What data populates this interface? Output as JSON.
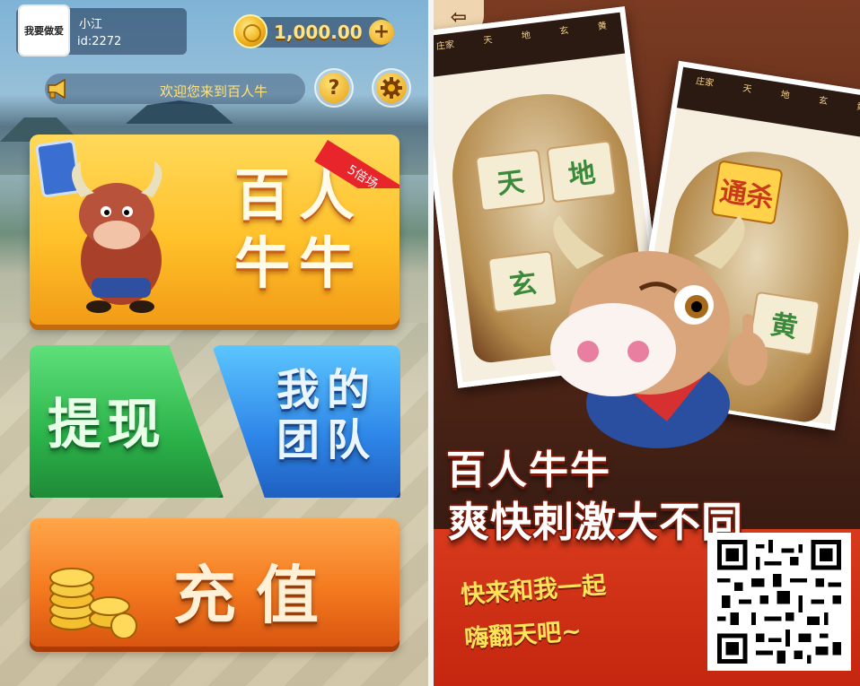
{
  "left_screen": {
    "profile": {
      "avatar_text": "我要做爱",
      "nickname": "小江",
      "user_id": "id:2272"
    },
    "balance": {
      "amount": "1,000.00",
      "add_symbol": "+"
    },
    "notice": {
      "text": "欢迎您来到百人牛"
    },
    "help_symbol": "?",
    "main_game": {
      "title": "百人牛牛",
      "badge": "5倍场"
    },
    "withdraw_label": "提现",
    "team_label": "我的团队",
    "recharge_label": "充值",
    "coin_glyph": "¥"
  },
  "right_promo": {
    "back_symbol": "⇦",
    "table_header": [
      "庄家",
      "天",
      "地",
      "玄",
      "黄"
    ],
    "seats": [
      "天",
      "地",
      "玄",
      "黄"
    ],
    "kill_label": "通杀",
    "slogan_line1": "百人牛牛",
    "slogan_line2": "爽快刺激大不同",
    "invite_line1": "快来和我一起",
    "invite_line2": "嗨翻天吧~"
  },
  "colors": {
    "gold": "#ffc12a",
    "green": "#2cb34a",
    "blue": "#2e86e8",
    "orange": "#f47a1f",
    "promo_red": "#c4260f"
  }
}
